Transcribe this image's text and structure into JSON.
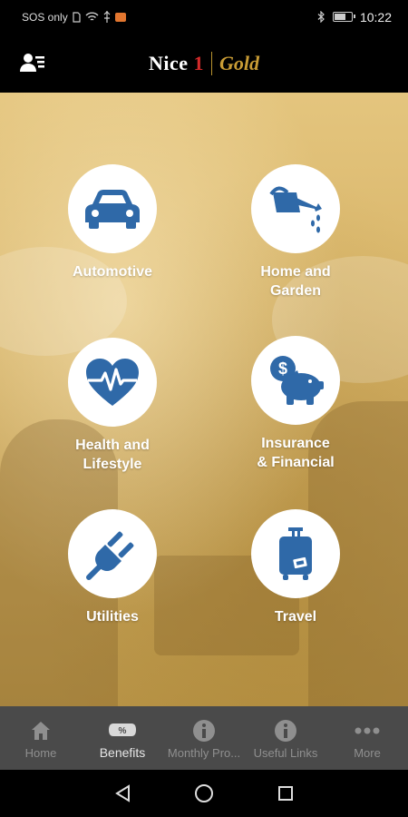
{
  "status_bar": {
    "carrier": "SOS only",
    "time": "10:22"
  },
  "header": {
    "brand_nice": "Nice",
    "brand_one": "1",
    "brand_gold": "Gold"
  },
  "categories": [
    {
      "label_line1": "Automotive",
      "label_line2": "",
      "icon": "car-icon"
    },
    {
      "label_line1": "Home and",
      "label_line2": "Garden",
      "icon": "watering-can-icon"
    },
    {
      "label_line1": "Health and",
      "label_line2": "Lifestyle",
      "icon": "heart-pulse-icon"
    },
    {
      "label_line1": "Insurance",
      "label_line2": "& Financial",
      "icon": "piggy-bank-icon"
    },
    {
      "label_line1": "Utilities",
      "label_line2": "",
      "icon": "plug-icon"
    },
    {
      "label_line1": "Travel",
      "label_line2": "",
      "icon": "suitcase-icon"
    }
  ],
  "bottom_nav": {
    "items": [
      {
        "label": "Home",
        "icon": "home-icon",
        "active": false
      },
      {
        "label": "Benefits",
        "icon": "discount-tag-icon",
        "active": true
      },
      {
        "label": "Monthly Pro...",
        "icon": "info-icon",
        "active": false
      },
      {
        "label": "Useful Links",
        "icon": "info-icon",
        "active": false
      },
      {
        "label": "More",
        "icon": "more-dots-icon",
        "active": false
      }
    ]
  },
  "colors": {
    "icon_blue": "#2f69a8",
    "brand_gold": "#c99c35",
    "nav_bg": "#4a4a4a"
  }
}
